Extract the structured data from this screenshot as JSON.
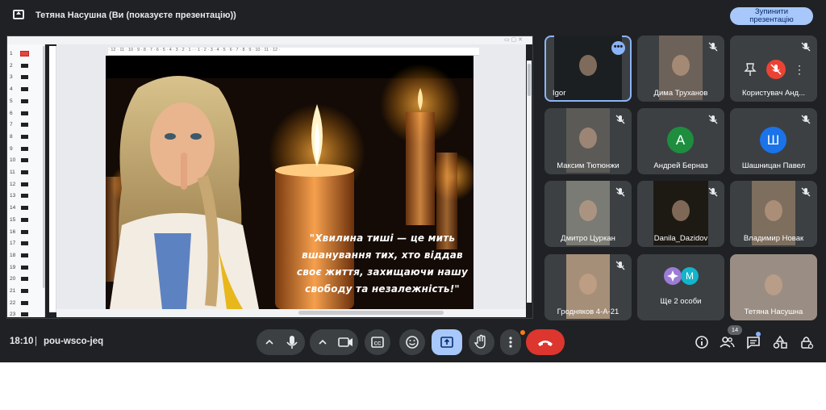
{
  "topbar": {
    "presenting_title": "Тетяна Насушна (Ви (показуєте презентацію))",
    "stop_button": "Зупинити презентацію"
  },
  "slides_panel": {
    "numbers": [
      "1",
      "2",
      "3",
      "4",
      "5",
      "6",
      "7",
      "8",
      "9",
      "10",
      "11",
      "12",
      "13",
      "14",
      "15",
      "16",
      "17",
      "18",
      "19",
      "20",
      "21",
      "22",
      "23"
    ]
  },
  "ruler": {
    "ticks": "· 12 · 11 · 10 · 9 · 8 · 7 · 6 · 5 · 4 · 3 · 2 · 1 · · 1 · 2 · 3 · 4 · 5 · 6 · 7 · 8 · 9 · 10 · 11 · 12 ·"
  },
  "slide": {
    "quote_line1": "\"Хвилина тиші — це мить",
    "quote_line2": "вшанування тих, хто віддав",
    "quote_line3": "своє життя, захищаючи нашу",
    "quote_line4": "свободу та незалежність!\""
  },
  "participants": [
    {
      "name": "Igor",
      "active": true
    },
    {
      "name": "Дима Труханов"
    },
    {
      "name": "Користувач Анд..."
    },
    {
      "name": "Максим Тютюнжи"
    },
    {
      "name": "Андрей Берназ",
      "initial": "А",
      "color": "#1e8e3e"
    },
    {
      "name": "Шашницан Павел",
      "initial": "Ш",
      "color": "#1a73e8"
    },
    {
      "name": "Дмитро Цуркан"
    },
    {
      "name": "Danila_Dazidov"
    },
    {
      "name": "Владимир Новак"
    },
    {
      "name": "Гродняков 4-А-21"
    },
    {
      "name": "Ще 2 особи",
      "initial": "М",
      "color": "#12b5cb"
    },
    {
      "name": "Тетяна Насушна"
    }
  ],
  "bottombar": {
    "time": "18:10",
    "separator": "|",
    "meeting_code": "pou-wsco-jeq",
    "people_count": "14"
  },
  "colors": {
    "background": "#202124",
    "tile": "#3c4043",
    "accent": "#a8c7fa",
    "end_call": "#dc362e"
  },
  "icons": [
    "present-icon",
    "mic-icon",
    "camera-icon",
    "captions-icon",
    "emoji-icon",
    "present-screen-icon",
    "raise-hand-icon",
    "more-icon",
    "end-call-icon",
    "info-icon",
    "people-icon",
    "chat-icon",
    "activities-icon",
    "host-controls-icon",
    "mic-off-icon",
    "pin-icon"
  ]
}
